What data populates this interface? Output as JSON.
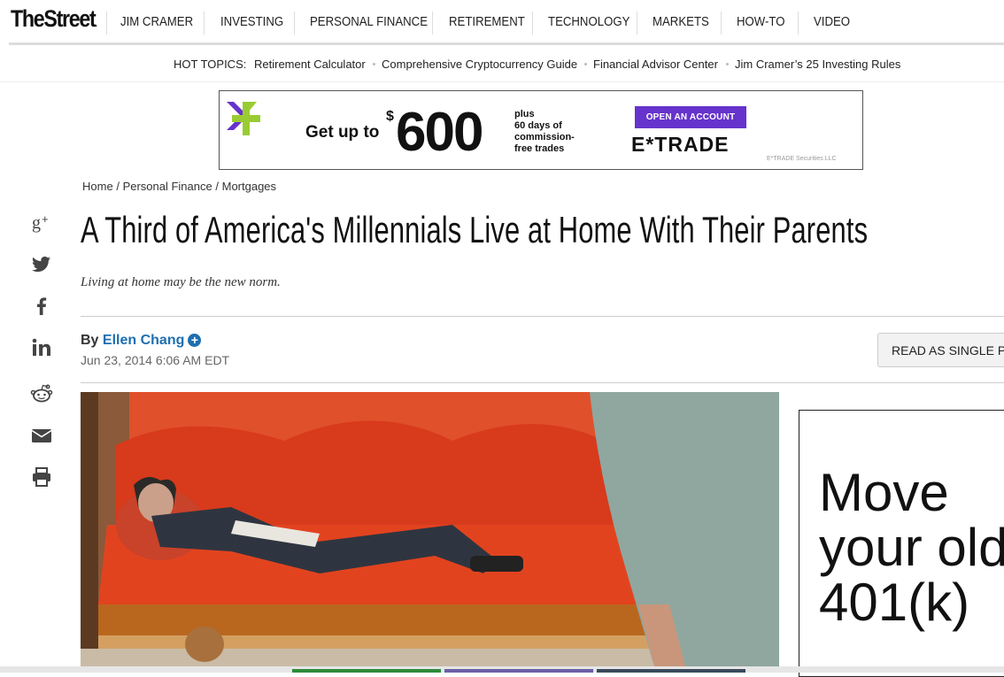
{
  "site": {
    "logo": "TheStreet",
    "logo_mark": "."
  },
  "nav": {
    "items": [
      "JIM CRAMER",
      "INVESTING",
      "PERSONAL FINANCE",
      "RETIREMENT",
      "TECHNOLOGY",
      "MARKETS",
      "HOW-TO",
      "VIDEO"
    ]
  },
  "hot_topics": {
    "label": "HOT TOPICS:",
    "links": [
      "Retirement Calculator",
      "Comprehensive Cryptocurrency Guide",
      "Financial Advisor Center",
      "Jim Cramer’s 25 Investing Rules"
    ]
  },
  "ad_banner": {
    "lead": "Get up to",
    "currency": "$",
    "amount": "600",
    "offer_lines": [
      "plus",
      "60 days of",
      "commission-",
      "free trades"
    ],
    "cta": "OPEN AN ACCOUNT",
    "brand": "E*TRADE",
    "legal": "E*TRADE Securities LLC",
    "accent_color": "#6633cc",
    "logo_colors": [
      "#6633cc",
      "#99cc33"
    ]
  },
  "breadcrumb": {
    "items": [
      "Home",
      "Personal Finance",
      "Mortgages"
    ],
    "separator": "/"
  },
  "share": {
    "icons": [
      "google-plus-icon",
      "twitter-icon",
      "facebook-icon",
      "linkedin-icon",
      "reddit-icon",
      "email-icon",
      "print-icon"
    ]
  },
  "article": {
    "headline": "A Third of America's Millennials Live at Home With Their Parents",
    "subhead": "Living at home may be the new norm.",
    "by_label": "By",
    "author": "Ellen Chang",
    "follow_symbol": "+",
    "date": "Jun 23, 2014 6:06 AM EDT",
    "read_single_label": "READ AS SINGLE PAGE"
  },
  "side_ad": {
    "lines": [
      "Move",
      "your old",
      "401(k)"
    ]
  }
}
